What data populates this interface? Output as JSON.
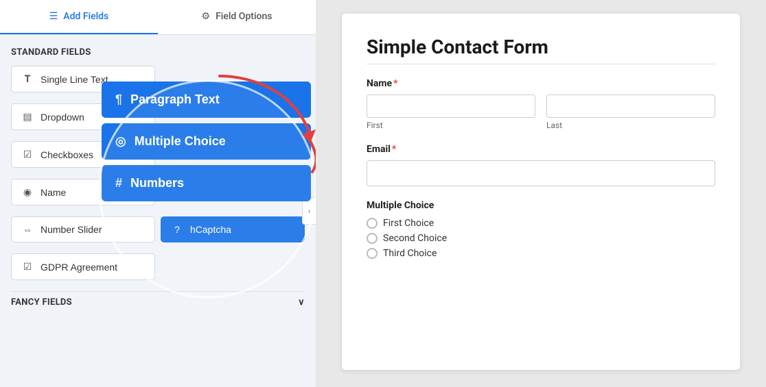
{
  "tabs": {
    "add_fields_label": "Add Fields",
    "field_options_label": "Field Options",
    "add_fields_icon": "☰",
    "field_options_icon": "⚙"
  },
  "standard_fields": {
    "section_title": "Standard Fields",
    "fields": [
      {
        "label": "Single Line Text",
        "icon": "T"
      },
      {
        "label": "Dropdown",
        "icon": "▤"
      },
      {
        "label": "Checkboxes",
        "icon": "☑"
      },
      {
        "label": "Name",
        "icon": "👤"
      },
      {
        "label": "Number Slider",
        "icon": "⇔"
      },
      {
        "label": "GDPR Agreement",
        "icon": "☑"
      }
    ]
  },
  "highlighted_buttons": [
    {
      "label": "Paragraph Text",
      "icon": "¶"
    },
    {
      "label": "Multiple Choice",
      "icon": "◎"
    },
    {
      "label": "Numbers",
      "icon": "#"
    },
    {
      "label": "hCaptcha",
      "icon": "?"
    }
  ],
  "fancy_section": {
    "title": "Fancy Fields",
    "chevron": "∨"
  },
  "form": {
    "title": "Simple Contact Form",
    "name_label": "Name",
    "name_required": "*",
    "first_placeholder": "",
    "first_sublabel": "First",
    "last_placeholder": "",
    "last_sublabel": "Last",
    "email_label": "Email",
    "email_required": "*",
    "email_placeholder": "",
    "mc_label": "Multiple Choice",
    "choices": [
      "First Choice",
      "Second Choice",
      "Third Choice"
    ]
  },
  "collapse_icon": "‹"
}
